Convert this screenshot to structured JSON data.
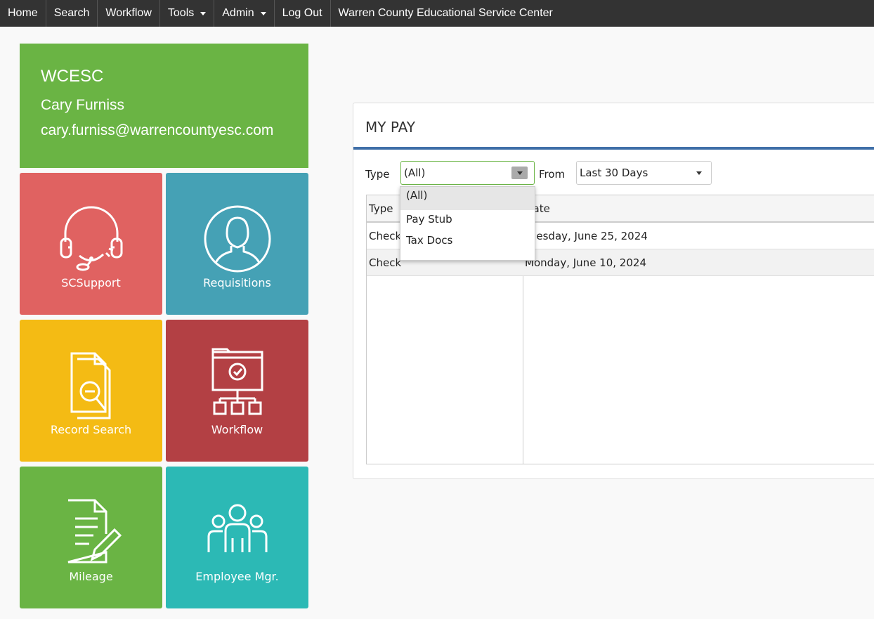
{
  "nav": {
    "items": [
      {
        "label": "Home",
        "dropdown": false
      },
      {
        "label": "Search",
        "dropdown": false
      },
      {
        "label": "Workflow",
        "dropdown": false
      },
      {
        "label": "Tools",
        "dropdown": true
      },
      {
        "label": "Admin",
        "dropdown": true
      },
      {
        "label": "Log Out",
        "dropdown": false
      }
    ],
    "org_name": "Warren County Educational Service Center"
  },
  "profile": {
    "org": "WCESC",
    "name": "Cary Furniss",
    "email": "cary.furniss@warrencountyesc.com"
  },
  "tiles": [
    {
      "label": "SCSupport",
      "color": "#e06261",
      "icon": "headset-icon"
    },
    {
      "label": "Requisitions",
      "color": "#45a1b5",
      "icon": "person-icon"
    },
    {
      "label": "Record Search",
      "color": "#f4bb14",
      "icon": "document-search-icon"
    },
    {
      "label": "Workflow",
      "color": "#b34044",
      "icon": "workflow-icon"
    },
    {
      "label": "Mileage",
      "color": "#6ab444",
      "icon": "document-edit-icon"
    },
    {
      "label": "Employee Mgr.",
      "color": "#2cb9b5",
      "icon": "group-icon"
    }
  ],
  "pay": {
    "title": "MY PAY",
    "type_label": "Type",
    "type_value": "(All)",
    "from_label": "From",
    "from_value": "Last 30 Days",
    "type_options": [
      "(All)",
      "Pay Stub",
      "Tax Docs"
    ],
    "columns": [
      "Type",
      "Date"
    ],
    "rows": [
      {
        "type": "Check",
        "date": "Tuesday, June 25, 2024"
      },
      {
        "type": "Check",
        "date": "Monday, June 10, 2024"
      }
    ]
  }
}
